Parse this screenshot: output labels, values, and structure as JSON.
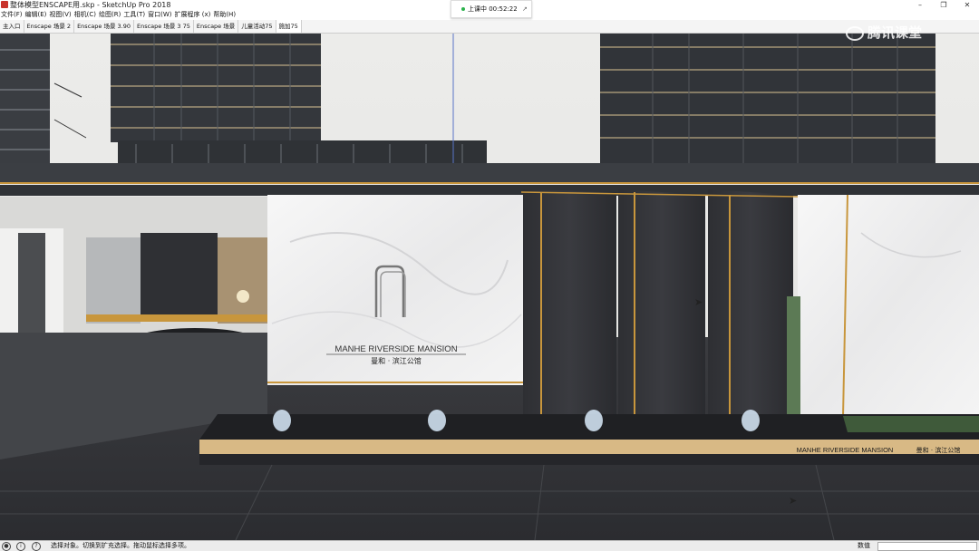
{
  "window": {
    "title": "整体模型ENSCAPE用.skp - SketchUp Pro 2018",
    "buttons": {
      "minimize": "–",
      "restore": "❐",
      "close": "✕"
    }
  },
  "menu": [
    "文件(F)",
    "编辑(E)",
    "视图(V)",
    "相机(C)",
    "绘图(R)",
    "工具(T)",
    "窗口(W)",
    "扩展程序 (x)",
    "帮助(H)"
  ],
  "scene_tabs": [
    "主入口",
    "Enscape 场景 2",
    "Enscape 场景 3.90",
    "Enscape 场景 3 75",
    "Enscape 场景",
    "儿童活动75",
    "施加75"
  ],
  "live_class": {
    "status": "上课中 00:52:22",
    "status_color": "#2bb24c"
  },
  "watermark": "腾讯课堂",
  "scene": {
    "wall_sign_en": "MANHE RIVERSIDE MANSION",
    "wall_sign_cn": "曼和 · 滨江公馆",
    "plinth_sign_en": "MANHE RIVERSIDE MANSION",
    "plinth_sign_cn": "曼和 · 滨江公馆",
    "accent_color": "#c8963c"
  },
  "statusbar": {
    "hint": "选择对象。切换到扩充选择。拖动鼠标选择多项。",
    "measurement_label": "数值"
  }
}
